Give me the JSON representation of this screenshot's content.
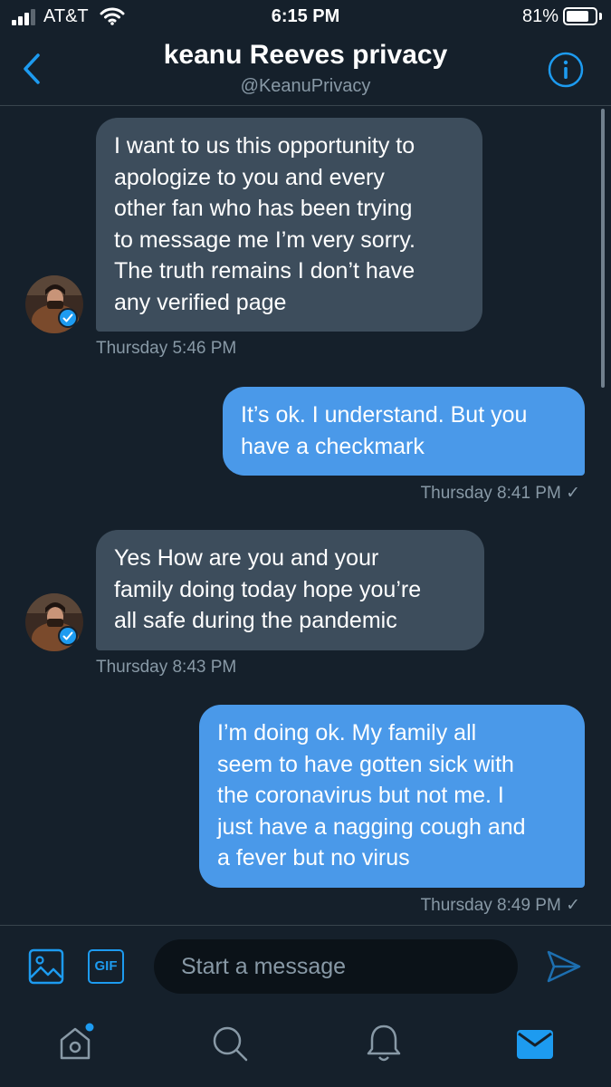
{
  "status_bar": {
    "carrier": "AT&T",
    "time": "6:15 PM",
    "battery": "81%",
    "battery_level": 0.81
  },
  "header": {
    "title": "keanu Reeves privacy",
    "handle": "@KeanuPrivacy"
  },
  "messages": [
    {
      "direction": "received",
      "lines": [
        "I want to us this opportunity to",
        "apologize to you and every",
        "other fan who has been trying",
        "to message me I’m very sorry.",
        "The truth remains I don’t have",
        "any verified page"
      ],
      "timestamp": "Thursday 5:46 PM"
    },
    {
      "direction": "sent",
      "lines": [
        "It’s ok. I understand. But you",
        "have a checkmark"
      ],
      "timestamp": "Thursday 8:41 PM ✓"
    },
    {
      "direction": "received",
      "lines": [
        "Yes How are you and your",
        "family doing today hope you’re",
        "all safe during the pandemic"
      ],
      "timestamp": "Thursday 8:43 PM"
    },
    {
      "direction": "sent",
      "lines": [
        "I’m doing ok. My family all",
        "seem to have gotten sick with",
        "the coronavirus but not me. I",
        "just have a nagging cough and",
        "a fever but no virus"
      ],
      "timestamp": "Thursday 8:49 PM ✓"
    }
  ],
  "composer": {
    "placeholder": "Start a message",
    "gif_label": "GIF"
  },
  "colors": {
    "background": "#15202b",
    "accent": "#1d9bf0",
    "sent_bubble": "#4a99e9",
    "received_bubble": "#3d4d5c",
    "muted": "#8899a6"
  },
  "icons": [
    "signal-icon",
    "wifi-icon",
    "battery-icon",
    "back-icon",
    "info-icon",
    "verified-icon",
    "image-icon",
    "gif-icon",
    "send-icon",
    "home-icon",
    "search-icon",
    "notifications-icon",
    "messages-icon"
  ]
}
